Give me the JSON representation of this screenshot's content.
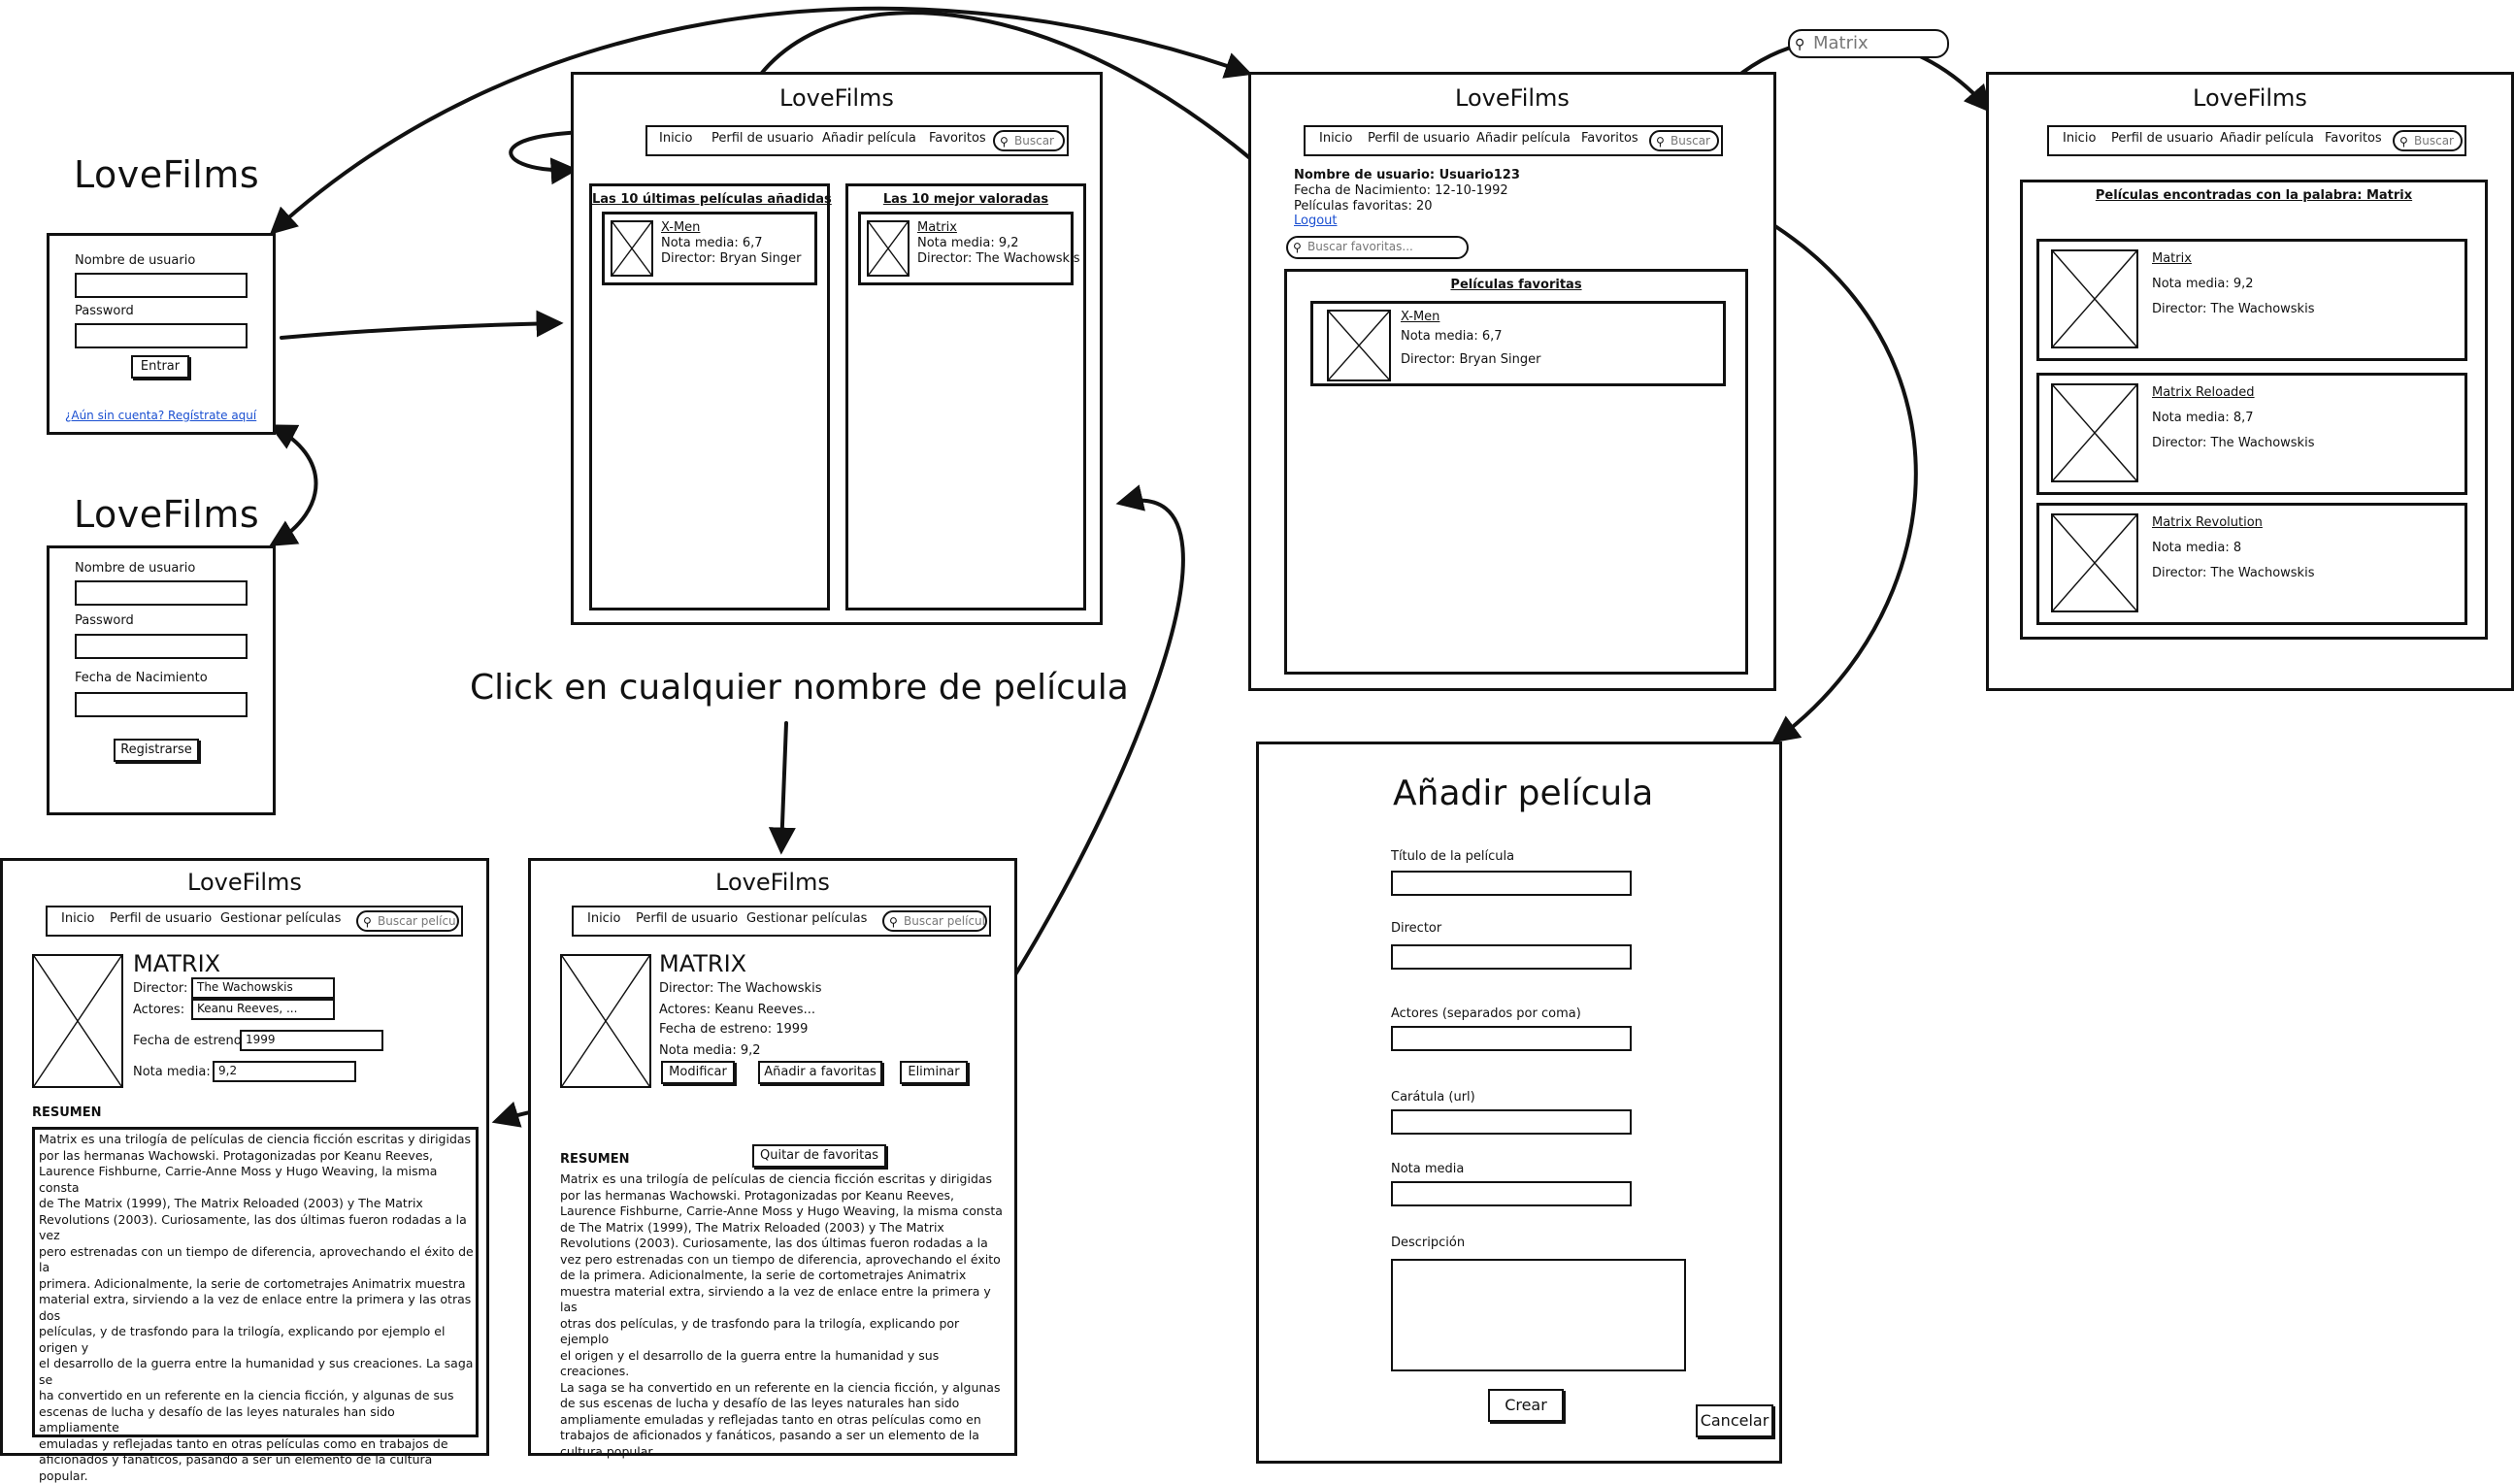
{
  "app_name": "LoveFilms",
  "nav": {
    "inicio": "Inicio",
    "perfil": "Perfil de usuario",
    "anadir": "Añadir película",
    "favoritos": "Favoritos",
    "buscar": "Buscar",
    "gestionar": "Gestionar películas",
    "buscar_pelicula": "Buscar película"
  },
  "login": {
    "username_label": "Nombre de usuario",
    "password_label": "Password",
    "enter_button": "Entrar",
    "register_link": "¿Aún sin cuenta? Regístrate aquí"
  },
  "register": {
    "username_label": "Nombre de usuario",
    "password_label": "Password",
    "birth_label": "Fecha de Nacimiento",
    "register_button": "Registrarse"
  },
  "home": {
    "latest_title": "Las 10 últimas películas añadidas",
    "top_title": "Las 10 mejor valoradas",
    "latest_item": {
      "title": "X-Men",
      "rating": "Nota media: 6,7",
      "director": "Director: Bryan Singer"
    },
    "top_item": {
      "title": "Matrix",
      "rating": "Nota media: 9,2",
      "director": "Director: The Wachowskis"
    }
  },
  "profile": {
    "username": "Nombre de usuario: Usuario123",
    "birth": "Fecha de Nacimiento: 12-10-1992",
    "fav_count": "Películas favoritas: 20",
    "logout": "Logout",
    "search_fav_placeholder": "Buscar favoritas...",
    "fav_title": "Películas favoritas",
    "fav_item": {
      "title": "X-Men",
      "rating": "Nota media: 6,7",
      "director": "Director: Bryan Singer"
    }
  },
  "search_query": "Matrix",
  "results": {
    "title": "Películas encontradas con la palabra: Matrix",
    "items": [
      {
        "title": "Matrix",
        "rating": "Nota media: 9,2",
        "director": "Director: The Wachowskis"
      },
      {
        "title": "Matrix Reloaded",
        "rating": "Nota media: 8,7",
        "director": "Director: The Wachowskis"
      },
      {
        "title": "Matrix Revolution",
        "rating": "Nota media: 8",
        "director": "Director: The Wachowskis"
      }
    ]
  },
  "caption": "Click en cualquier nombre de película",
  "edit_movie": {
    "title": "MATRIX",
    "director_label": "Director:",
    "director_value": "The Wachowskis",
    "actors_label": "Actores:",
    "actors_value": "Keanu Reeves, ...",
    "release_label": "Fecha de estreno:",
    "release_value": "1999",
    "rating_label": "Nota media:",
    "rating_value": "9,2",
    "summary_label": "RESUMEN",
    "summary": "Matrix es una trilogía de películas de ciencia ficción escritas y dirigidas\npor las hermanas Wachowski. Protagonizadas por Keanu Reeves,\nLaurence Fishburne, Carrie-Anne Moss y Hugo Weaving, la misma consta\nde The Matrix (1999), The Matrix Reloaded (2003) y The Matrix\nRevolutions (2003). Curiosamente, las dos últimas fueron rodadas a la vez\npero estrenadas con un tiempo de diferencia, aprovechando el éxito de la\nprimera. Adicionalmente, la serie de cortometrajes Animatrix muestra\nmaterial extra, sirviendo a la vez de enlace entre la primera y las otras dos\npelículas, y de trasfondo para la trilogía, explicando por ejemplo el origen y\nel desarrollo de la guerra entre la humanidad y sus creaciones. La saga se\nha convertido en un referente en la ciencia ficción, y algunas de sus\nescenas de lucha y desafío de las leyes naturales han sido ampliamente\nemuladas y reflejadas tanto en otras películas como en trabajos de\naficionados y fanáticos, pasando a ser un elemento de la cultura popular."
  },
  "movie": {
    "title": "MATRIX",
    "director": "Director: The Wachowskis",
    "actors": "Actores: Keanu Reeves...",
    "release": "Fecha de estreno: 1999",
    "rating": "Nota media: 9,2",
    "modify_button": "Modificar",
    "add_fav_button": "Añadir a favoritas",
    "delete_button": "Eliminar",
    "remove_fav_button": "Quitar de favoritas",
    "summary_label": "RESUMEN",
    "summary": "Matrix es una trilogía de películas de ciencia ficción escritas y dirigidas\npor las hermanas Wachowski. Protagonizadas por Keanu Reeves,\nLaurence Fishburne, Carrie-Anne Moss y Hugo Weaving, la misma consta\nde The Matrix (1999), The Matrix Reloaded (2003) y The Matrix\nRevolutions (2003). Curiosamente, las dos últimas fueron rodadas a la\nvez pero estrenadas con un tiempo de diferencia, aprovechando el éxito\nde la primera. Adicionalmente, la serie de cortometrajes Animatrix\nmuestra material extra, sirviendo a la vez de enlace entre la primera y las\notras dos películas, y de trasfondo para la trilogía, explicando por ejemplo\nel origen y el desarrollo de la guerra entre la humanidad y sus creaciones.\nLa saga se ha convertido en un referente en la ciencia ficción, y algunas\nde sus escenas de lucha y desafío de las leyes naturales han sido\nampliamente emuladas y reflejadas tanto en otras películas como en\ntrabajos de aficionados y fanáticos, pasando a ser un elemento de la\ncultura popular."
  },
  "add_movie": {
    "title": "Añadir película",
    "title_label": "Título de la película",
    "director_label": "Director",
    "actors_label": "Actores (separados por coma)",
    "cover_label": "Carátula (url)",
    "rating_label": "Nota media",
    "description_label": "Descripción",
    "create_button": "Crear",
    "cancel_button": "Cancelar"
  }
}
